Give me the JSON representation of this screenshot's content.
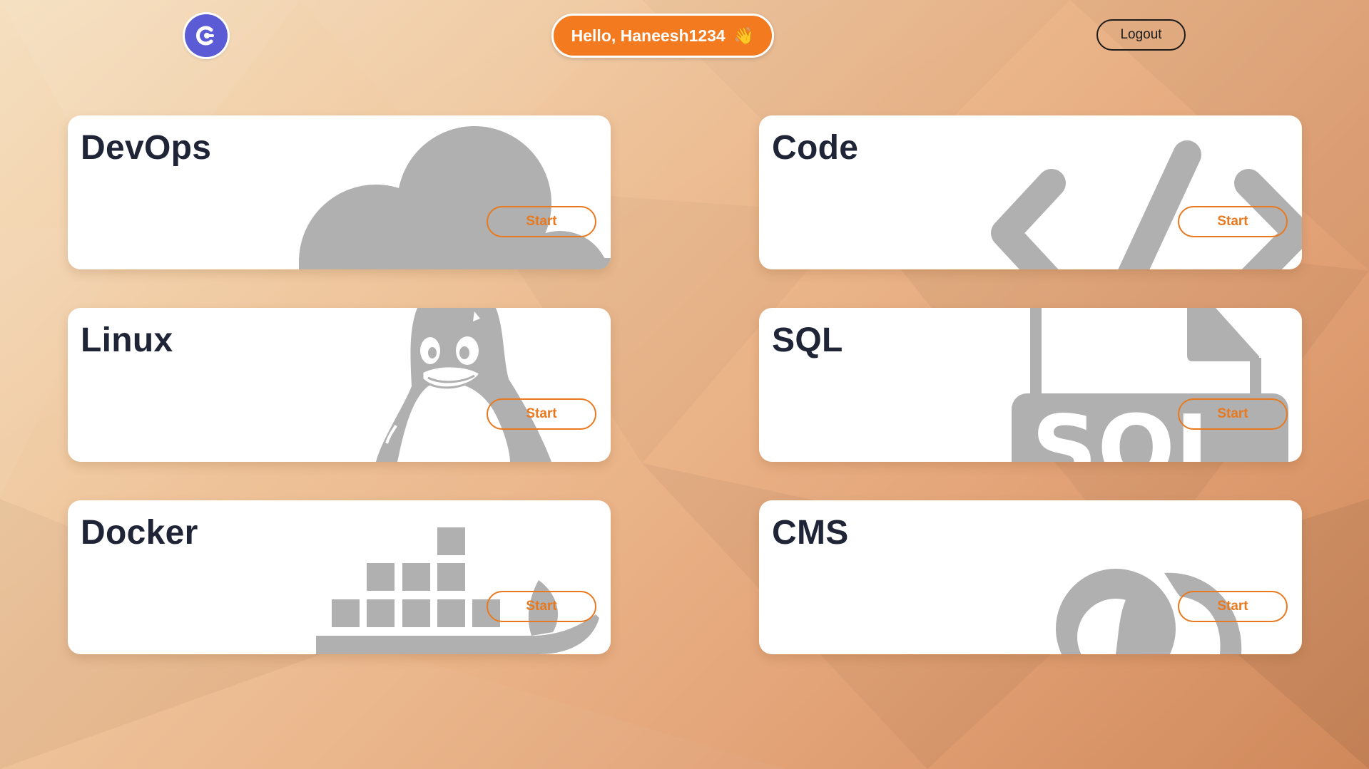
{
  "header": {
    "logo_icon": "power-c-logo-icon",
    "greeting_text": "Hello, Haneesh1234",
    "greeting_emoji": "👋",
    "logout_label": "Logout"
  },
  "colors": {
    "accent": "#f47a1f",
    "start_button": "#e9791f",
    "logo_bg": "#5b5bd6",
    "title_text": "#1f2536",
    "art_gray": "#b0b0b0"
  },
  "cards": [
    {
      "title": "DevOps",
      "icon": "cloud-icon",
      "start_label": "Start"
    },
    {
      "title": "Code",
      "icon": "code-brackets-icon",
      "start_label": "Start"
    },
    {
      "title": "Linux",
      "icon": "tux-penguin-icon",
      "start_label": "Start"
    },
    {
      "title": "SQL",
      "icon": "sql-file-icon",
      "start_label": "Start"
    },
    {
      "title": "Docker",
      "icon": "docker-whale-icon",
      "start_label": "Start"
    },
    {
      "title": "CMS",
      "icon": "cms-icon",
      "start_label": "Start"
    }
  ]
}
